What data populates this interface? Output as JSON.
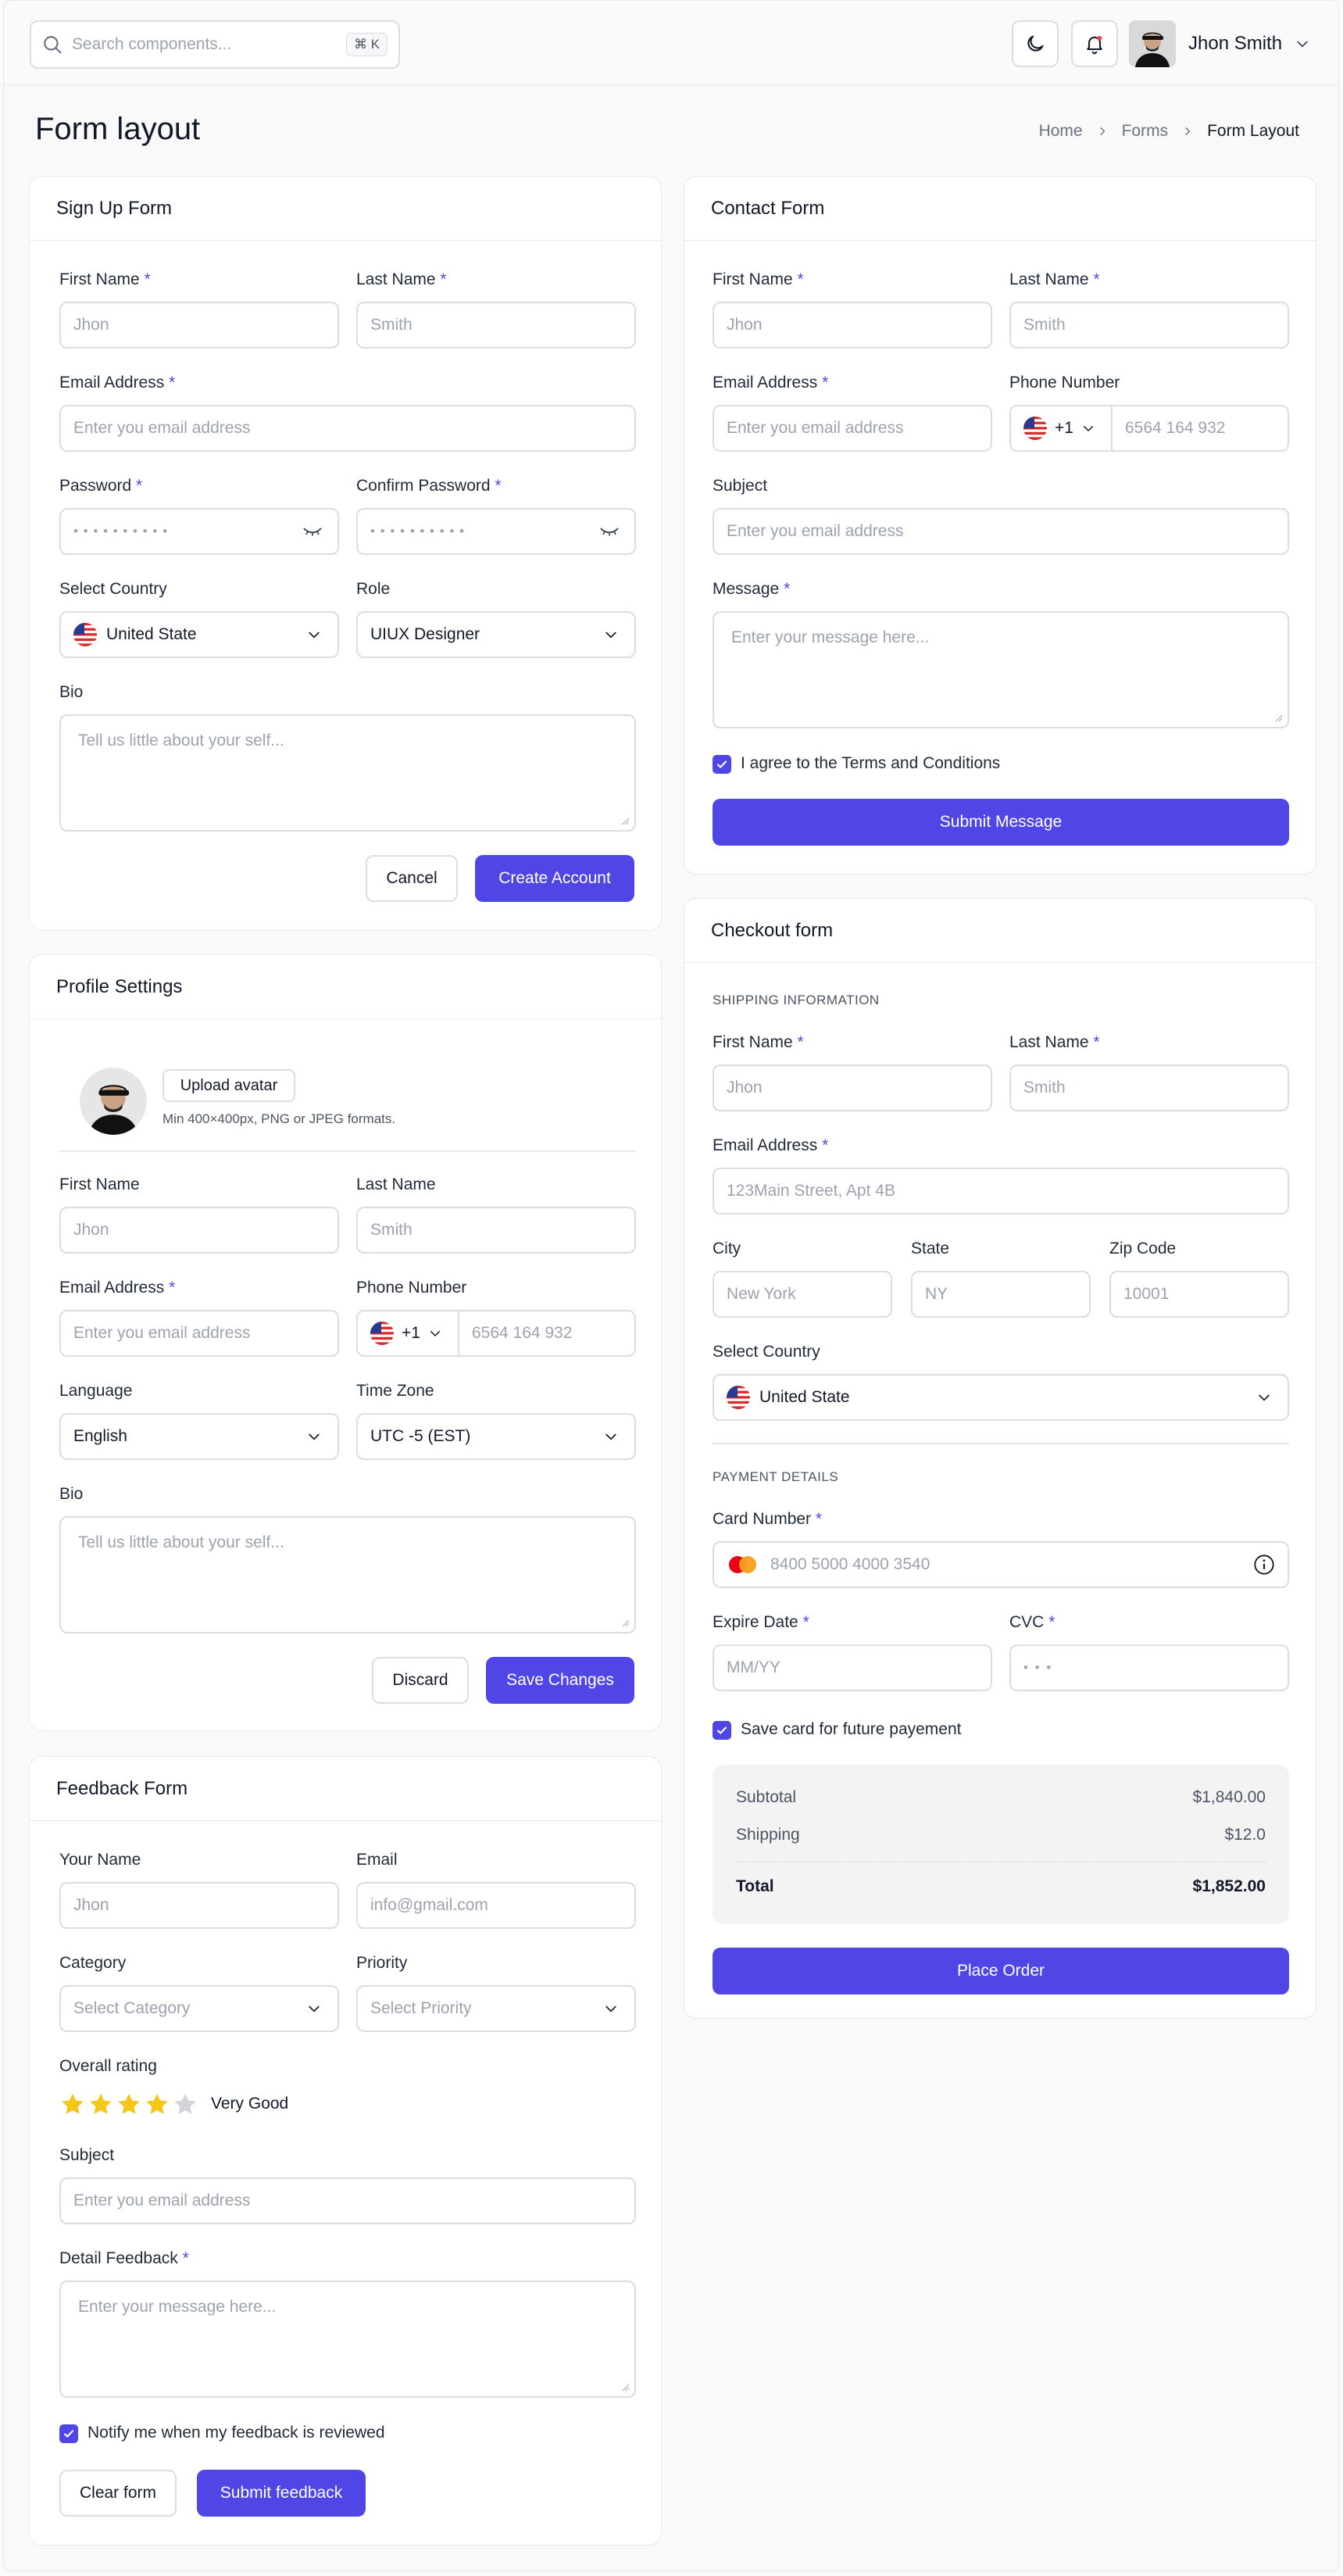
{
  "header": {
    "search_placeholder": "Search components...",
    "shortcut": "⌘ K",
    "theme_icon": "moon-icon",
    "notification_icon": "bell-icon",
    "user_name": "Jhon Smith"
  },
  "page": {
    "title": "Form layout",
    "breadcrumb": [
      "Home",
      "Forms",
      "Form Layout"
    ]
  },
  "signup": {
    "title": "Sign Up Form",
    "first_name_label": "First Name",
    "first_name_placeholder": "Jhon",
    "last_name_label": "Last Name",
    "last_name_placeholder": "Smith",
    "email_label": "Email Address",
    "email_placeholder": "Enter you email address",
    "password_label": "Password",
    "password_value": "• • • • • • • • • •",
    "confirm_label": "Confirm Password",
    "confirm_value": "• • • • • • • • • •",
    "country_label": "Select Country",
    "country_value": "United State",
    "role_label": "Role",
    "role_value": "UIUX Designer",
    "bio_label": "Bio",
    "bio_placeholder": "Tell us little about your self...",
    "cancel": "Cancel",
    "create": "Create Account"
  },
  "profile": {
    "title": "Profile Settings",
    "upload": "Upload avatar",
    "upload_hint": "Min 400×400px, PNG or JPEG formats.",
    "first_name_label": "First Name",
    "first_name_placeholder": "Jhon",
    "last_name_label": "Last Name",
    "last_name_placeholder": "Smith",
    "email_label": "Email Address",
    "email_placeholder": "Enter you email address",
    "phone_label": "Phone Number",
    "phone_prefix": "+1",
    "phone_placeholder": "6564 164 932",
    "language_label": "Language",
    "language_value": "English",
    "timezone_label": "Time Zone",
    "timezone_value": "UTC -5 (EST)",
    "bio_label": "Bio",
    "bio_placeholder": "Tell us little about your self...",
    "discard": "Discard",
    "save": "Save Changes"
  },
  "feedback": {
    "title": "Feedback Form",
    "name_label": "Your Name",
    "name_placeholder": "Jhon",
    "email_label": "Email",
    "email_placeholder": "info@gmail.com",
    "category_label": "Category",
    "category_placeholder": "Select Category",
    "priority_label": "Priority",
    "priority_placeholder": "Select Priority",
    "rating_label": "Overall rating",
    "rating": 4,
    "rating_max": 5,
    "rating_text": "Very Good",
    "subject_label": "Subject",
    "subject_placeholder": "Enter you email address",
    "detail_label": "Detail Feedback",
    "detail_placeholder": "Enter your message here...",
    "notify_label": "Notify me when my feedback is reviewed",
    "clear": "Clear form",
    "submit": "Submit feedback"
  },
  "contact": {
    "title": "Contact Form",
    "first_name_label": "First Name",
    "first_name_placeholder": "Jhon",
    "last_name_label": "Last Name",
    "last_name_placeholder": "Smith",
    "email_label": "Email Address",
    "email_placeholder": "Enter you email address",
    "phone_label": "Phone Number",
    "phone_prefix": "+1",
    "phone_placeholder": "6564 164 932",
    "subject_label": "Subject",
    "subject_placeholder": "Enter you email address",
    "message_label": "Message",
    "message_placeholder": "Enter your message here...",
    "agree_label": "I agree to the Terms and Conditions",
    "submit": "Submit Message"
  },
  "checkout": {
    "title": "Checkout form",
    "shipping_title": "SHIPPING INFORMATION",
    "first_name_label": "First Name",
    "first_name_placeholder": "Jhon",
    "last_name_label": "Last Name",
    "last_name_placeholder": "Smith",
    "email_label": "Email Address",
    "email_placeholder": "123Main Street, Apt 4B",
    "city_label": "City",
    "city_placeholder": "New York",
    "state_label": "State",
    "state_placeholder": "NY",
    "zip_label": "Zip Code",
    "zip_placeholder": "10001",
    "country_label": "Select Country",
    "country_value": "United State",
    "payment_title": "PAYMENT DETAILS",
    "card_label": "Card Number",
    "card_placeholder": "8400 5000 4000 3540",
    "expire_label": "Expire Date",
    "expire_placeholder": "MM/YY",
    "cvc_label": "CVC",
    "cvc_placeholder": "• • •",
    "save_card_label": "Save card for future payement",
    "subtotal_label": "Subtotal",
    "subtotal_value": "$1,840.00",
    "shipping_label": "Shipping",
    "shipping_value": "$12.0",
    "total_label": "Total",
    "total_value": "$1,852.00",
    "place_order": "Place Order"
  },
  "colors": {
    "accent": "#5046e6",
    "star": "#f5c518",
    "star_empty": "#d1d5db"
  }
}
